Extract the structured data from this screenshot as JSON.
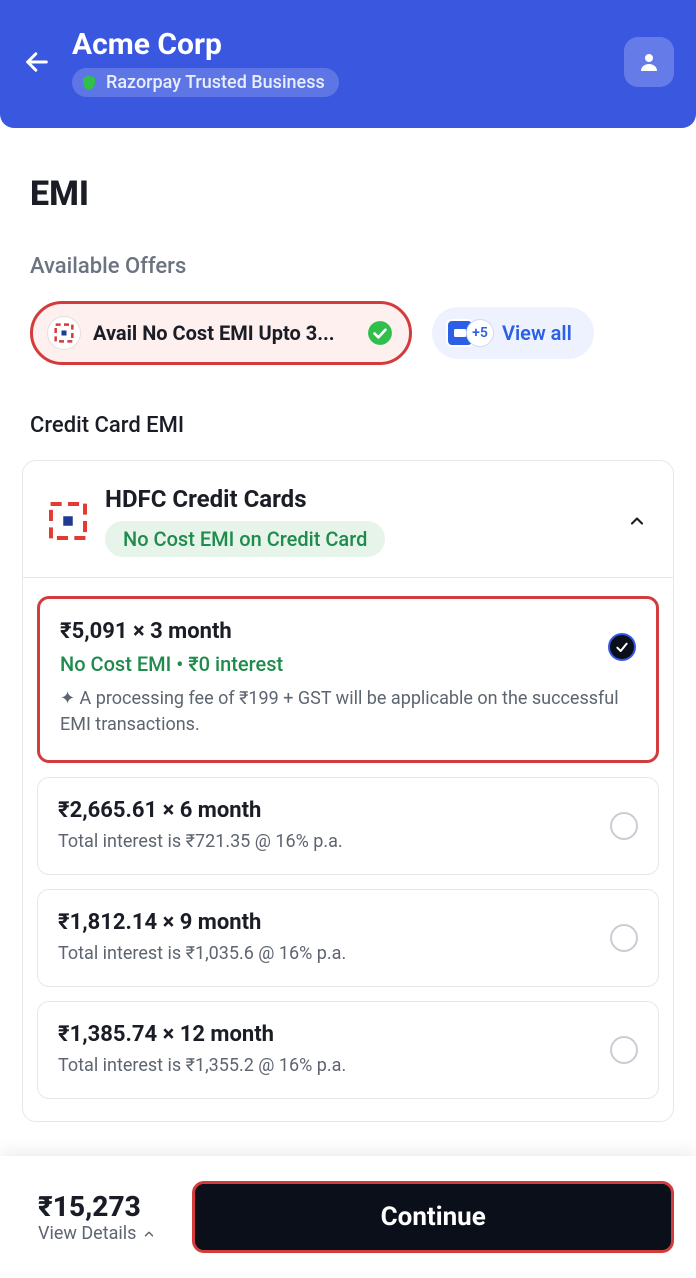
{
  "header": {
    "company": "Acme Corp",
    "trust_label": "Razorpay Trusted Business"
  },
  "page": {
    "title": "EMI",
    "offers_label": "Available Offers"
  },
  "offers": {
    "main_offer_text": "Avail No Cost EMI Upto 3...",
    "stack_count": "+5",
    "view_all_label": "View all"
  },
  "credit_emi": {
    "section_title": "Credit Card EMI",
    "bank_name": "HDFC Credit Cards",
    "bank_badge": "No Cost EMI on Credit Card"
  },
  "plans": [
    {
      "title": "₹5,091 × 3 month",
      "sub": "No Cost EMI • ₹0 interest",
      "note": "✦ A processing fee of ₹199 + GST will be applicable on the successful EMI transactions.",
      "selected": true
    },
    {
      "title": "₹2,665.61 × 6 month",
      "interest": "Total interest is ₹721.35 @ 16% p.a.",
      "selected": false
    },
    {
      "title": "₹1,812.14 × 9 month",
      "interest": "Total interest is ₹1,035.6 @ 16% p.a.",
      "selected": false
    },
    {
      "title": "₹1,385.74 × 12 month",
      "interest": "Total interest is ₹1,355.2 @ 16% p.a.",
      "selected": false
    }
  ],
  "footer": {
    "amount": "₹15,273",
    "view_details_label": "View Details",
    "continue_label": "Continue"
  }
}
